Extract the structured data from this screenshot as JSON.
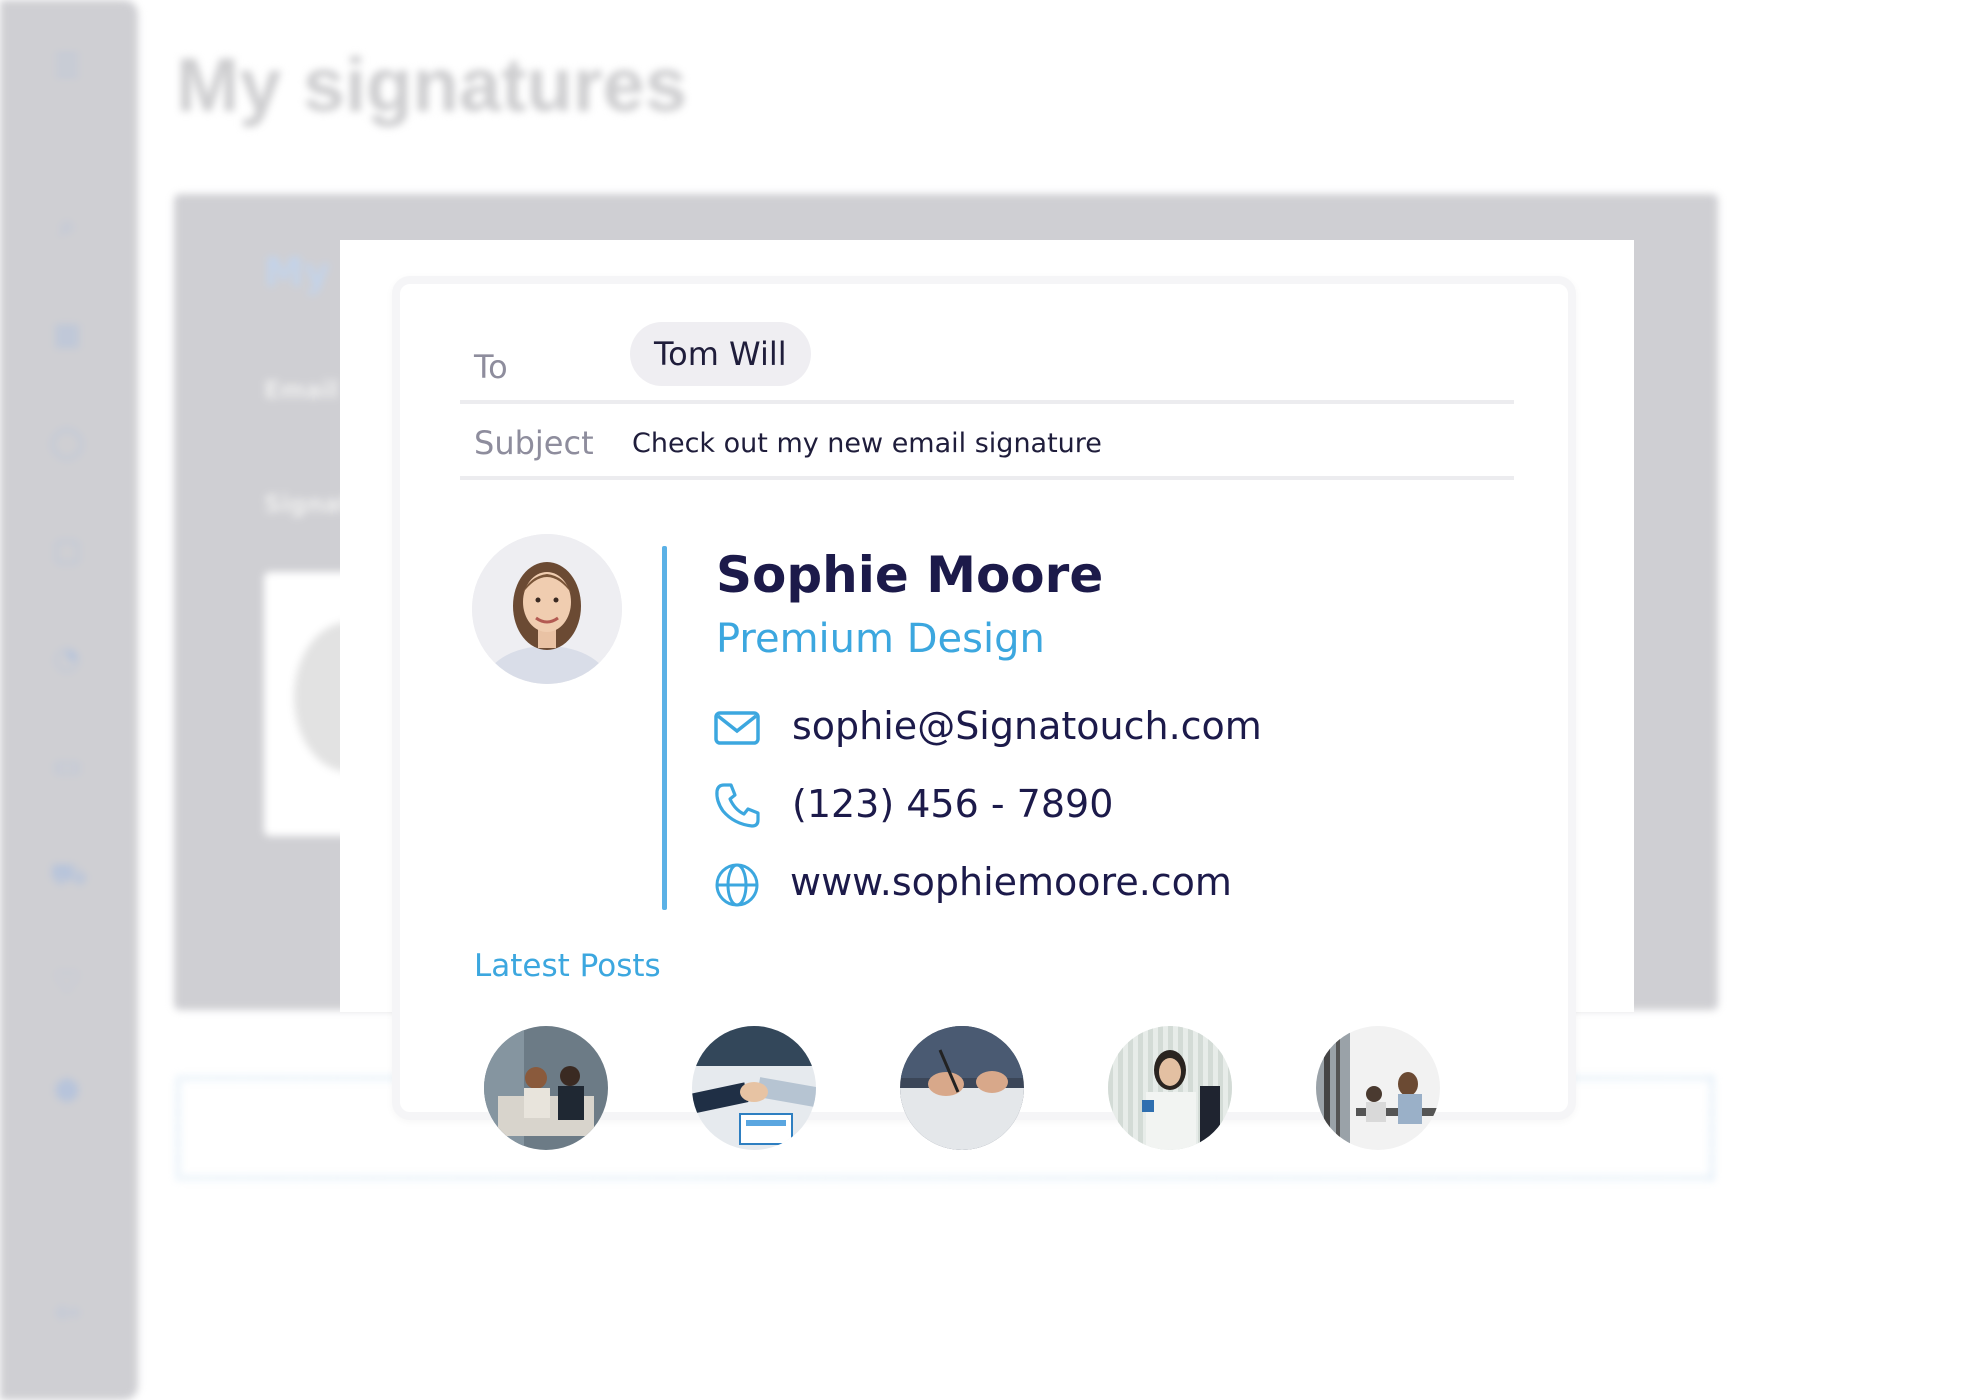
{
  "background": {
    "page_title": "My signatures",
    "panel_title": "My",
    "email_label": "Email",
    "signature_label": "Signat",
    "sidebar_icons": [
      "menu-icon",
      "search-icon",
      "grid-icon",
      "user-icon",
      "chat-icon",
      "chart-icon",
      "briefcase-icon",
      "cart-icon",
      "heart-icon",
      "settings-icon",
      "logout-icon"
    ]
  },
  "email": {
    "to_label": "To",
    "recipient": "Tom Will",
    "subject_label": "Subject",
    "subject": "Check out my new email signature"
  },
  "signature": {
    "name": "Sophie Moore",
    "title": "Premium Design",
    "email": "sophie@Signatouch.com",
    "phone": "(123) 456 - 7890",
    "website": "www.sophiemoore.com",
    "latest_posts_label": "Latest Posts",
    "posts": [
      "team-meeting-photo",
      "handshake-photo",
      "signing-document-photo",
      "woman-with-coffee-photo",
      "office-workspace-photo"
    ]
  },
  "colors": {
    "navy": "#1c1a4a",
    "accent_blue": "#3ca7df",
    "divider_blue": "#5bb1e6",
    "label_gray": "#8e8d9d",
    "chip_bg": "#efeef2"
  }
}
